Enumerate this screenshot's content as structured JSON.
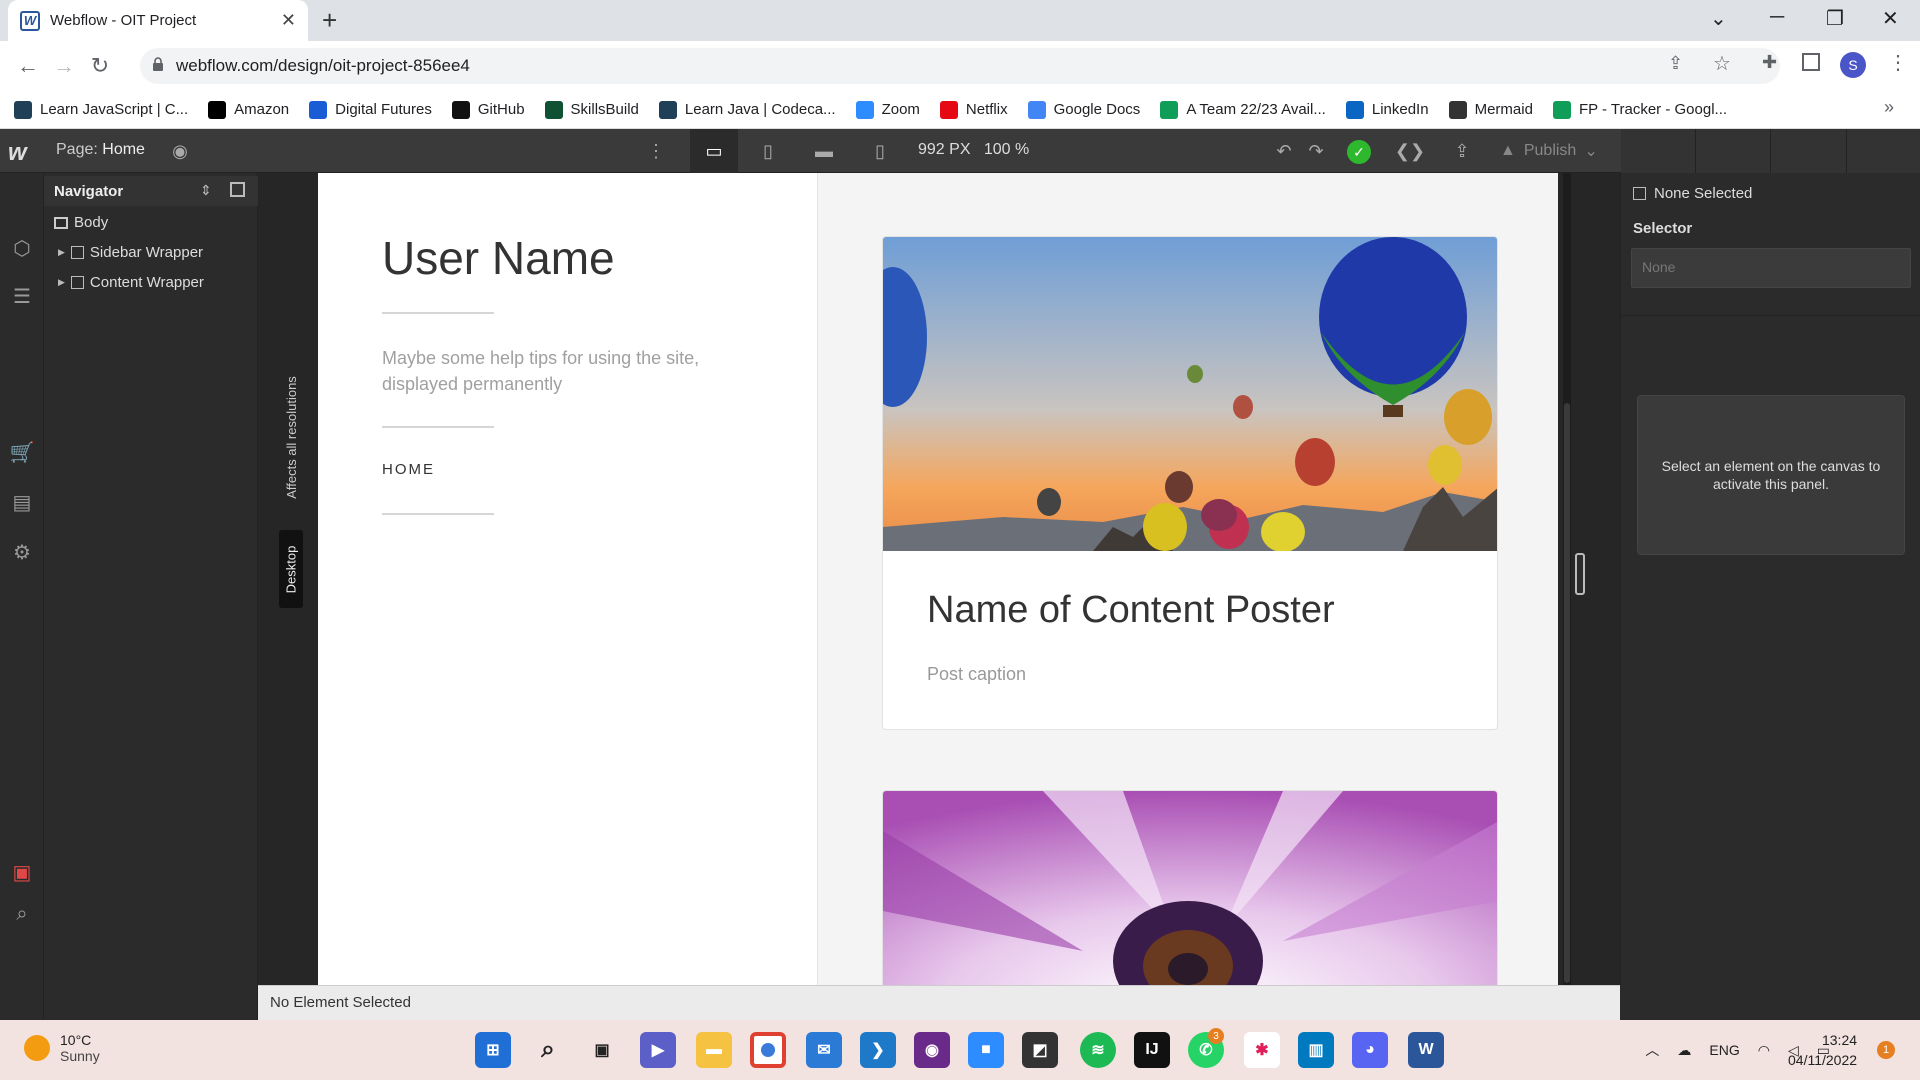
{
  "browser": {
    "tab_title": "Webflow - OIT Project",
    "tab_favicon": "W",
    "url": "webflow.com/design/oit-project-856ee4",
    "profile_initial": "S",
    "bookmarks": [
      {
        "label": "Learn JavaScript | C...",
        "icon": "codecademy-icon",
        "color": "#1f4056"
      },
      {
        "label": "Amazon",
        "icon": "amazon-icon",
        "color": "#000000"
      },
      {
        "label": "Digital Futures",
        "icon": "digital-futures-icon",
        "color": "#1a5bd6"
      },
      {
        "label": "GitHub",
        "icon": "github-icon",
        "color": "#111111"
      },
      {
        "label": "SkillsBuild",
        "icon": "skillsbuild-icon",
        "color": "#0f5132"
      },
      {
        "label": "Learn Java | Codeca...",
        "icon": "codecademy-icon",
        "color": "#1f4056"
      },
      {
        "label": "Zoom",
        "icon": "zoom-icon",
        "color": "#2d8cff"
      },
      {
        "label": "Netflix",
        "icon": "netflix-icon",
        "color": "#e50914"
      },
      {
        "label": "Google Docs",
        "icon": "google-docs-icon",
        "color": "#4285f4"
      },
      {
        "label": "A Team 22/23 Avail...",
        "icon": "google-sheets-icon",
        "color": "#0f9d58"
      },
      {
        "label": "LinkedIn",
        "icon": "linkedin-icon",
        "color": "#0a66c2"
      },
      {
        "label": "Mermaid",
        "icon": "mermaid-icon",
        "color": "#333333"
      },
      {
        "label": "FP - Tracker - Googl...",
        "icon": "google-sheets-icon",
        "color": "#0f9d58"
      }
    ],
    "bookmarks_overflow": "»"
  },
  "webflow": {
    "page_label": "Page:",
    "page_name": "Home",
    "viewport_width": "992 PX",
    "zoom": "100 %",
    "publish_label": "Publish",
    "navigator": {
      "title": "Navigator",
      "items": [
        {
          "label": "Body"
        },
        {
          "label": "Sidebar Wrapper"
        },
        {
          "label": "Content Wrapper"
        }
      ]
    },
    "breakpoint_labels": {
      "affects": "Affects all resolutions",
      "device": "Desktop"
    },
    "right_panel": {
      "none_selected": "None Selected",
      "selector_label": "Selector",
      "selector_placeholder": "None",
      "hint": "Select an element on the canvas to activate this panel."
    },
    "status": "No Element Selected"
  },
  "site": {
    "user_name": "User Name",
    "tips": "Maybe some help tips for using the site, displayed permanently",
    "nav_home": "HOME",
    "card1": {
      "title": "Name of Content Poster",
      "caption": "Post caption"
    }
  },
  "taskbar": {
    "weather_temp": "10°C",
    "weather_desc": "Sunny",
    "whatsapp_badge": "3",
    "lang": "ENG",
    "time": "13:24",
    "date": "04/11/2022",
    "notif_count": "1"
  },
  "colors": {
    "webflow_bg": "#2b2b2b",
    "accent_green": "#2eb82e",
    "webflow_blue": "#4353ff"
  }
}
